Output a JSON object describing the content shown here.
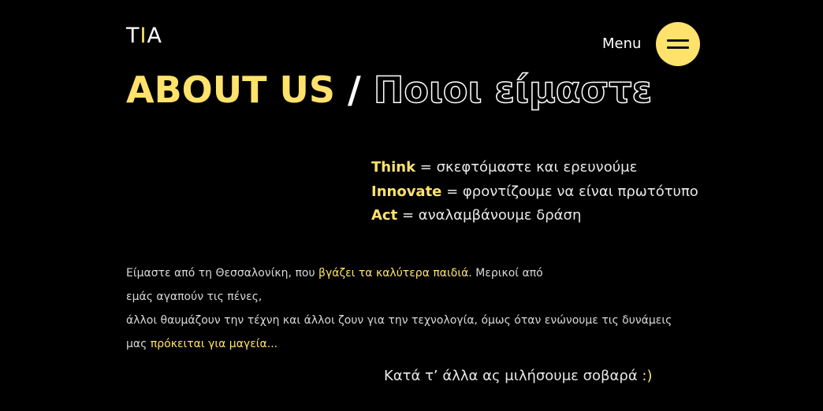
{
  "logo": {
    "left": "T",
    "mid": "I",
    "right": "A"
  },
  "menu": {
    "label": "Menu"
  },
  "headline": {
    "english": "ABOUT US",
    "separator": " / ",
    "greek": "Ποιοι είμαστε"
  },
  "tia": [
    {
      "term": "Think",
      "definition": " = σκεφτόμαστε και ερευνούμε"
    },
    {
      "term": "Innovate",
      "definition": " = φροντίζουμε να είναι πρωτότυπο"
    },
    {
      "term": "Act",
      "definition": " = αναλαμβάνουμε δράση"
    }
  ],
  "body": {
    "line1_a": "Είμαστε από τη Θεσσαλονίκη, που ",
    "line1_highlight": "βγάζει τα καλύτερα παιδιά.",
    "line1_b": " Μερικοί από",
    "line2": "εμάς αγαπούν τις πένες,",
    "line3": "άλλοι θαυμάζουν την τέχνη και άλλοι ζουν για την τεχνολογία, όμως όταν ενώνουμε τις δυνάμεις",
    "line4_a": "μας ",
    "line4_highlight": "πρόκειται για μαγεία..."
  },
  "closing": {
    "text": "Κατά τ’ άλλα ας μιλήσουμε σοβαρά ",
    "smile": ":)"
  },
  "colors": {
    "accent": "#ffe26b",
    "background": "#000000",
    "text": "#ffffff"
  }
}
